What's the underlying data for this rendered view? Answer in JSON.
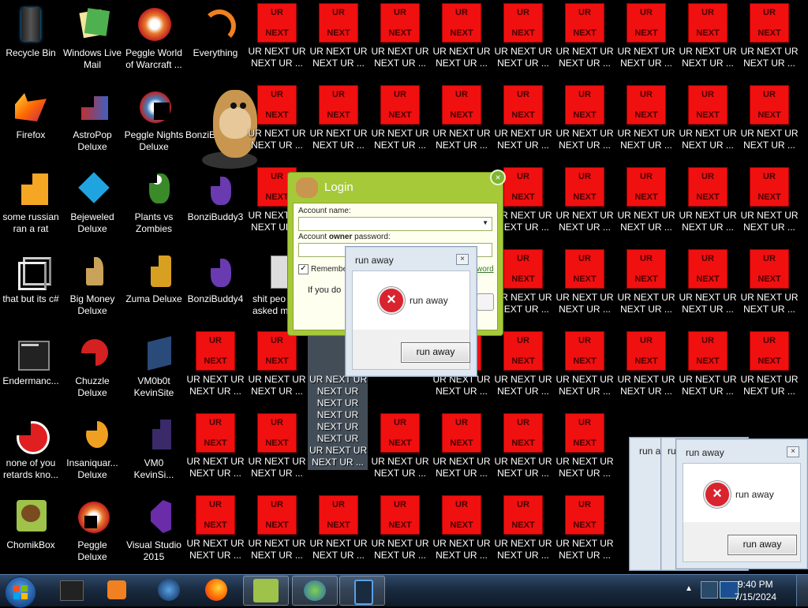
{
  "desktop": {
    "col0": [
      "Recycle Bin",
      "Firefox",
      "some russian ran a rat",
      "that but its c#",
      "Endermanc...",
      "none of you retards kno...",
      "ChomikBox"
    ],
    "col1": [
      "Windows Live Mail",
      "AstroPop Deluxe",
      "Bejeweled Deluxe",
      "Big Money Deluxe",
      "Chuzzle Deluxe",
      "Insaniquar... Deluxe",
      "Peggle Deluxe"
    ],
    "col2": [
      "Peggle World of Warcraft ...",
      "Peggle Nights Deluxe",
      "Plants vs Zombies",
      "Zuma Deluxe",
      "VM0b0t KevinSite",
      "VM0 KevinSi...",
      "Visual Studio 2015"
    ],
    "col3": [
      "Everything",
      "BonziB",
      "BonziBuddy3",
      "BonziBuddy4"
    ],
    "col4_r3": "shit peo asked m",
    "ur_label_top": "UR",
    "ur_label_bottom": "NEXT",
    "ur_caption": "UR NEXT UR NEXT UR ...",
    "ur_stack": "UR NEXT UR\nNEXT UR\nNEXT UR\nNEXT UR\nNEXT UR\nNEXT UR\nUR NEXT UR\nNEXT UR ..."
  },
  "login": {
    "title": "Login",
    "account_name_label": "Account name:",
    "password_label_pre": "Account ",
    "password_label_bold": "owner",
    "password_label_post": " password:",
    "remember_label": "Remembe",
    "hint_text": "If you do",
    "forgot_link": "word"
  },
  "dialog_main": {
    "title": "run away",
    "message": "run away",
    "button": "run away"
  },
  "dialog_right": {
    "title": "run away",
    "message": "run away",
    "button": "run away",
    "behind_title_1": "run a",
    "behind_title_2": "run a"
  },
  "taskbar": {
    "time": "9:40 PM",
    "date": "7/15/2024",
    "items": [
      "desktop-app",
      "media-player",
      "web-browser",
      "firefox",
      "chomikbox",
      "messenger",
      "device"
    ]
  },
  "colors": {
    "ur_red": "#f01010",
    "taskbar": "#1a2b40",
    "login_green": "#a6c93a"
  }
}
